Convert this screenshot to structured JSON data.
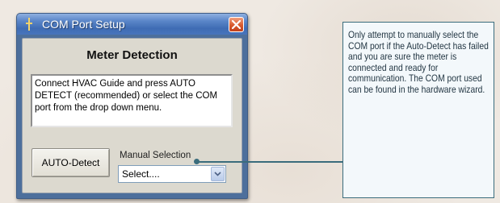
{
  "window": {
    "title": "COM Port Setup",
    "heading": "Meter Detection",
    "instructions": "Connect HVAC Guide and press AUTO DETECT (recommended) or select the COM port from the drop down menu.",
    "auto_detect_label": "AUTO-Detect",
    "manual_selection_label": "Manual Selection",
    "port_select": {
      "selected_value": "Select...."
    }
  },
  "callout": {
    "text": "Only attempt to manually select the COM port if the Auto-Detect has failed and you are sure the meter is connected and ready for communication. The COM port used can be found in the hardware wizard."
  },
  "icons": {
    "app_icon": "app-icon",
    "close": "close-icon",
    "dropdown": "chevron-down-icon"
  },
  "colors": {
    "titlebar": "#4774bb",
    "close_button": "#d85a2e",
    "callout_border": "#3a6c7c"
  }
}
